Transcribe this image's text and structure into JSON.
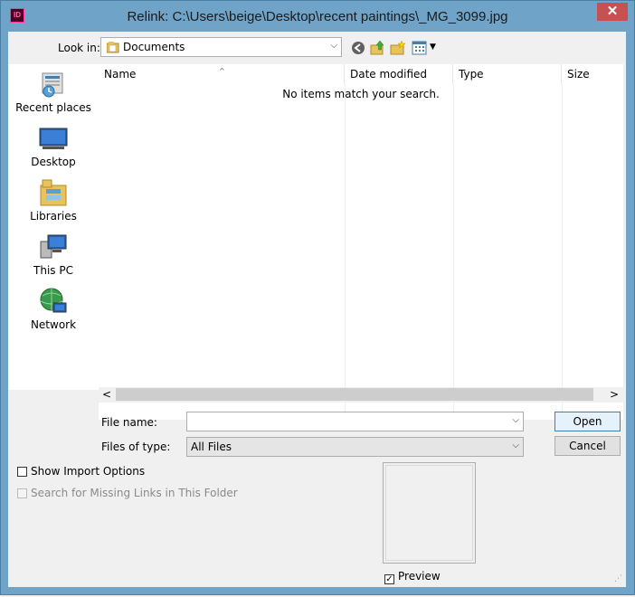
{
  "window": {
    "app_icon": "ID",
    "title": "Relink: C:\\Users\\beige\\Desktop\\recent paintings\\_MG_3099.jpg",
    "close_glyph": "✕"
  },
  "lookin": {
    "label": "Look in:",
    "value": "Documents",
    "arrow": "⌵"
  },
  "toolbar": {
    "back_icon": "back-arrow-icon",
    "up_icon": "up-folder-icon",
    "new_folder_icon": "new-folder-icon",
    "views_icon": "view-menu-icon",
    "views_arrow": "▼"
  },
  "places": [
    {
      "label": "Recent places",
      "icon": "recent-places-icon"
    },
    {
      "label": "Desktop",
      "icon": "desktop-icon"
    },
    {
      "label": "Libraries",
      "icon": "libraries-icon"
    },
    {
      "label": "This PC",
      "icon": "this-pc-icon"
    },
    {
      "label": "Network",
      "icon": "network-icon"
    }
  ],
  "filelist": {
    "columns": [
      "Name",
      "Date modified",
      "Type",
      "Size"
    ],
    "sort_arrow": "^",
    "empty_message": "No items match your search."
  },
  "scroll": {
    "left": "<",
    "right": ">"
  },
  "filename": {
    "label": "File name:",
    "value": "",
    "arrow": "⌵"
  },
  "filetype": {
    "label": "Files of type:",
    "value": "All Files",
    "arrow": "⌵"
  },
  "buttons": {
    "open": "Open",
    "cancel": "Cancel"
  },
  "options": {
    "show_import": {
      "label": "Show Import Options",
      "checked": false
    },
    "search_missing": {
      "label": "Search for Missing Links in This Folder",
      "checked": false,
      "disabled": true
    },
    "preview": {
      "label": "Preview",
      "checked": true,
      "check_glyph": "✓"
    }
  },
  "colors": {
    "frame": "#6fa4c8",
    "close": "#c75050",
    "dialog_bg": "#f0f0f0"
  }
}
